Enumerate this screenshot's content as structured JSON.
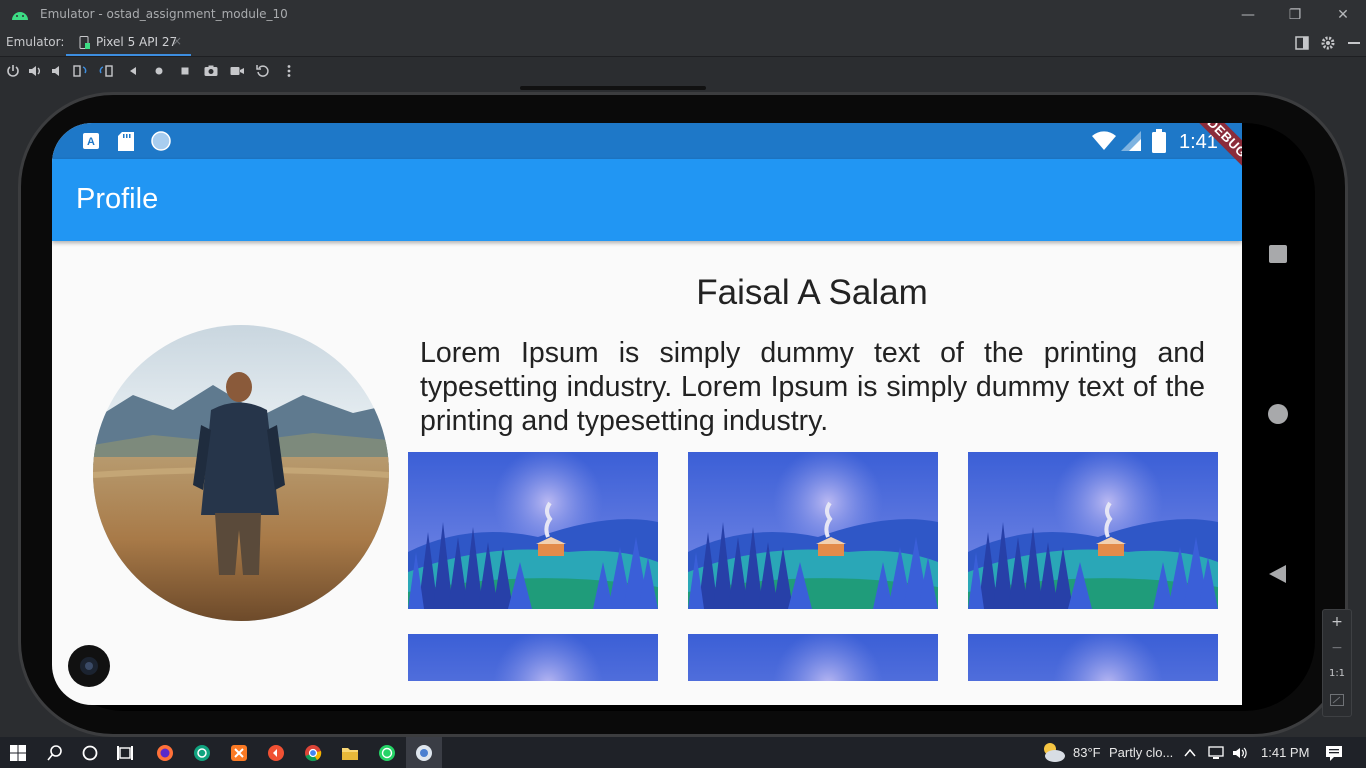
{
  "window": {
    "title": "Emulator - ostad_assignment_module_10",
    "minimize_glyph": "—",
    "restore_glyph": "❐",
    "close_glyph": "✕"
  },
  "tabbar": {
    "label": "Emulator:",
    "tab_name": "Pixel 5 API 27",
    "tab_close_glyph": "×"
  },
  "toolbar": {
    "icons": [
      "power-icon",
      "volume-up-icon",
      "volume-down-icon",
      "rotate-left-icon",
      "rotate-right-icon",
      "back-icon",
      "home-icon",
      "overview-icon",
      "screenshot-icon",
      "record-icon",
      "replay-icon",
      "more-icon"
    ]
  },
  "phone": {
    "status_time": "1:41",
    "debug_banner": "DEBUG",
    "appbar_title": "Profile",
    "profile_name": "Faisal A Salam",
    "description": "Lorem Ipsum is simply dummy text of the printing and typesetting industry. Lorem Ipsum is simply dummy text of the printing and typesetting industry.",
    "accent_color": "#2196f3",
    "status_color": "#1e78c8"
  },
  "zoom": {
    "plus": "+",
    "minus": "−",
    "one_to_one": "1:1"
  },
  "taskbar": {
    "weather_temp": "83°F",
    "weather_desc": "Partly clo...",
    "clock": "1:41 PM"
  }
}
